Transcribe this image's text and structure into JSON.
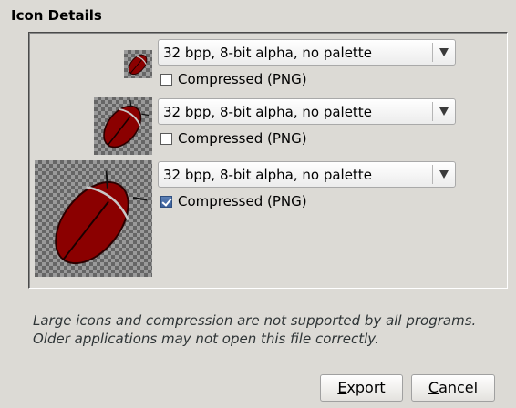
{
  "section": {
    "title": "Icon Details"
  },
  "icons": [
    {
      "format": "32 bpp, 8-bit alpha, no palette",
      "compressed_label": "Compressed (PNG)",
      "compressed": false
    },
    {
      "format": "32 bpp, 8-bit alpha, no palette",
      "compressed_label": "Compressed (PNG)",
      "compressed": false
    },
    {
      "format": "32 bpp, 8-bit alpha, no palette",
      "compressed_label": "Compressed (PNG)",
      "compressed": true
    }
  ],
  "note": {
    "text": "Large icons and compression are not supported by all programs. Older applications may not open this file correctly."
  },
  "buttons": {
    "export_first": "E",
    "export_rest": "xport",
    "cancel_first": "C",
    "cancel_rest": "ancel"
  },
  "colors": {
    "window_bg": "#dcdad5",
    "beetle": "#8b0000",
    "checkbox_checked": "#3b5f9a"
  },
  "icon_names": {
    "preview": "bug-icon",
    "dropdown": "chevron-down-icon"
  }
}
